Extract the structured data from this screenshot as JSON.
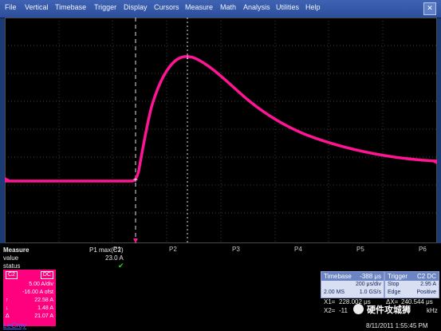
{
  "menu": [
    "File",
    "Vertical",
    "Timebase",
    "Trigger",
    "Display",
    "Cursors",
    "Measure",
    "Math",
    "Analysis",
    "Utilities",
    "Help"
  ],
  "close_icon": "✕",
  "screen": {
    "trace_color": "#ff1493",
    "trigger_level_marker_label": "T",
    "pins": [
      "P1",
      "P2",
      "P3",
      "P4",
      "P5",
      "P6"
    ]
  },
  "measure": {
    "title": "Measure",
    "row_value_label": "value",
    "row_status_label": "status",
    "param_name": "P1 max(C2)",
    "param_value": "23.0 A",
    "status_icon": "check-icon"
  },
  "channel": {
    "name": "C2",
    "badge": "DC",
    "volts_div": "5.00 A/div",
    "offset": "-16.00 A ofst",
    "rows": [
      {
        "label": "↑",
        "value": "22.58 A"
      },
      {
        "label": "↓",
        "value": "1.48 A"
      },
      {
        "label": "Δ",
        "value": "21.07 A"
      }
    ]
  },
  "timebase": {
    "title": "Timebase",
    "value": "-388 μs",
    "row1": "200 μs/div",
    "row2_left": "2.00 MS",
    "row2_right": "1.0 GS/s"
  },
  "trigger": {
    "title": "Trigger",
    "badges": "C2 DC",
    "row1_left": "Stop",
    "row1_right": "2.95 A",
    "row2_left": "Edge",
    "row2_right": "Positive"
  },
  "cursors": {
    "x1_label": "X1=",
    "x1_value": "228.002 μs",
    "dx_label": "ΔX=",
    "dx_value": "240.544 μs",
    "x2_label": "X2=",
    "x2_value": "-11",
    "freq_label": "kHz"
  },
  "brand": "LeCroy",
  "watermark": "硬件攻城狮",
  "datetime": "8/11/2011 1:55:45 PM"
}
